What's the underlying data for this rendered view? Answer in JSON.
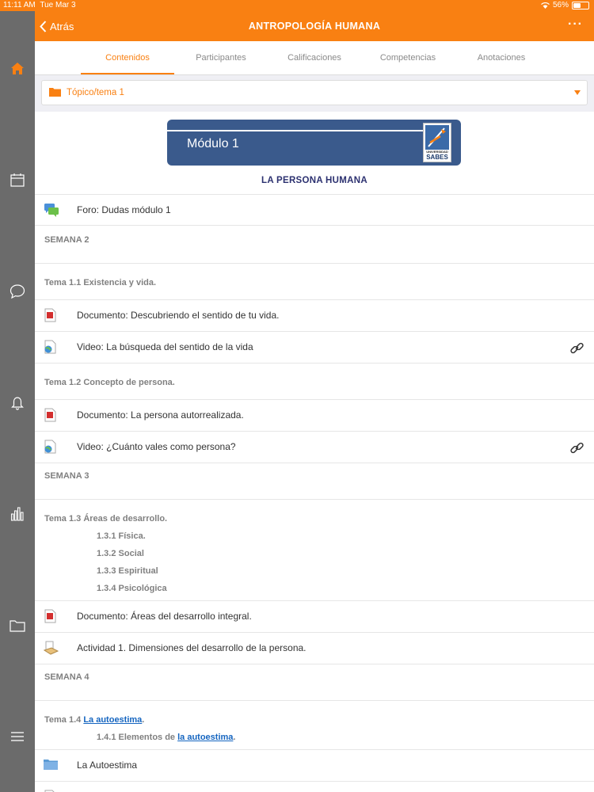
{
  "status": {
    "time": "11:11 AM",
    "date": "Tue Mar 3",
    "battery": "56%",
    "battery_level": 0.56
  },
  "nav": {
    "back_label": "Atrás",
    "title": "ANTROPOLOGÍA HUMANA",
    "more": "···"
  },
  "sidebar": {
    "items": [
      {
        "icon": "home-icon"
      },
      {
        "icon": "calendar-icon"
      },
      {
        "icon": "messages-icon"
      },
      {
        "icon": "bell-icon"
      },
      {
        "icon": "grades-icon"
      },
      {
        "icon": "folder-icon"
      },
      {
        "icon": "menu-icon"
      }
    ]
  },
  "tabs": [
    "Contenidos",
    "Participantes",
    "Calificaciones",
    "Competencias",
    "Anotaciones"
  ],
  "topic": {
    "label": "Tópico/tema 1"
  },
  "colors": {
    "accent": "#f98012",
    "sidebar": "#6b6b6b",
    "heading": "#2c3170",
    "link": "#1565c0"
  },
  "module": {
    "banner_title": "Módulo 1",
    "logo_univ": "UNIVERSIDAD",
    "logo_brand": "SABES",
    "heading": "LA PERSONA HUMANA",
    "forum": "Foro: Dudas módulo 1",
    "semana2": "SEMANA 2",
    "tema11": "Tema 1.1 Existencia y vida.",
    "doc1": "Documento: Descubriendo el sentido de tu vida.",
    "video1": "Video: La búsqueda del sentido de la vida",
    "tema12": "Tema 1.2 Concepto de persona.",
    "doc2": "Documento: La persona autorrealizada.",
    "video2": "Video: ¿Cuánto vales como persona?",
    "semana3": "SEMANA 3",
    "tema13": "Tema 1.3 Áreas de desarrollo.",
    "sub131": "1.3.1 Física.",
    "sub132": "1.3.2 Social",
    "sub133": "1.3.3 Espiritual",
    "sub134": "1.3.4 Psicológica",
    "doc3": "Documento: Áreas del desarrollo integral.",
    "act1": "Actividad 1. Dimensiones del desarrollo de la persona.",
    "semana4": "SEMANA 4",
    "tema14_prefix": "Tema 1.4 ",
    "tema14_link": "La autoestima",
    "tema14_suffix": ".",
    "sub141_prefix": "1.4.1 Elementos de ",
    "sub141_link": "la autoestima",
    "sub141_suffix": ".",
    "folder1": "La Autoestima"
  }
}
